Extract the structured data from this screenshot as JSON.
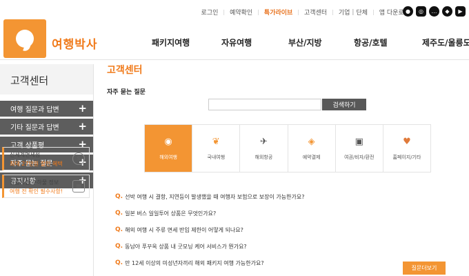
{
  "util": {
    "links": [
      "로그인",
      "예약확인",
      "특가라이브",
      "고객센터",
      "기업",
      "단체",
      "앱 다운로드"
    ]
  },
  "logo": {
    "text": "여행박사"
  },
  "gnb": [
    "패키지여행",
    "자유여행",
    "부산/지방",
    "항공/호텔",
    "제주도/울릉도"
  ],
  "sidebar": {
    "title": "고객센터",
    "items": [
      "여행 질문과 답변",
      "기타 질문과 답변",
      "고객 상품평",
      "자주 묻는 질문",
      "공지사항"
    ],
    "banners": [
      {
        "line1": "신세계면세점",
        "line2": "최대 27만원 할인 혜택"
      },
      {
        "line1": "항공사별 수하물 정보",
        "line2": "여행 전 확인 필수사항!"
      }
    ]
  },
  "content": {
    "title": "고객센터",
    "subtitle": "자주 묻는 질문",
    "search_button": "검색하기",
    "categories": [
      "해외여행",
      "국내여행",
      "해외항공",
      "예약결제",
      "여권/비자/환전",
      "홈페이지/기타"
    ],
    "faqs": [
      "선박 여행 시 결항, 지연등이 발생했을 때 여행자 보험으로 보장이 가능한가요?",
      "일본 버스 일일투어 상품은 무엇인가요?",
      "해외 여행 시 주류 면세 반입 제한이 어떻게 되나요?",
      "동남아 푸꾸옥 상품 내 굿모닝 케어 서비스가 뭔가요?",
      "만 12세 이상의 미성년자끼리 해외 패키지 여행 가능한가요?"
    ],
    "more_button": "질문더보기"
  },
  "colors": {
    "accent": "#f39533",
    "sidebar": "#5d5d5d"
  }
}
